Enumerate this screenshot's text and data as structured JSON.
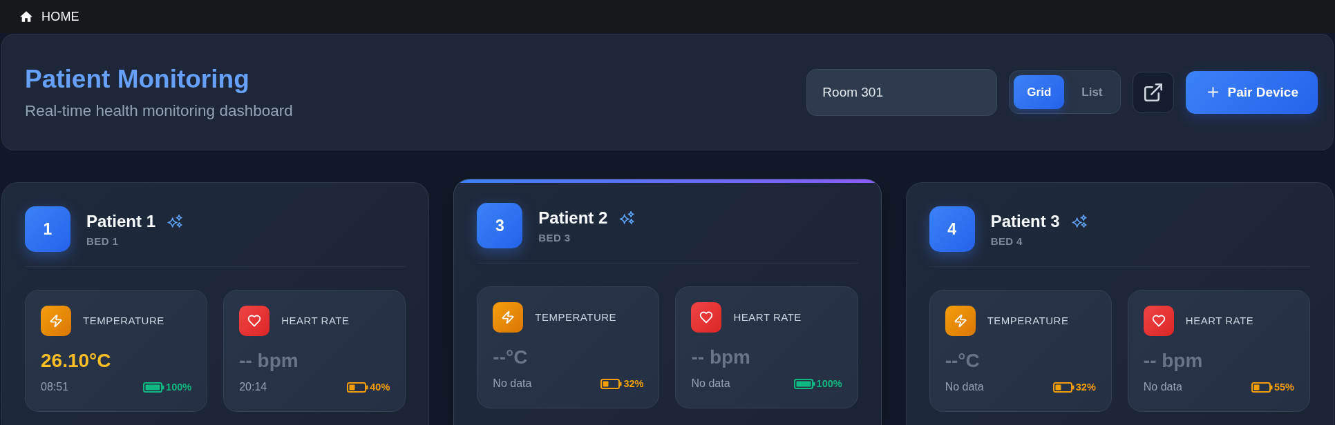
{
  "top_bar": {
    "home_link": "HOME"
  },
  "header": {
    "title": "Patient Monitoring",
    "subtitle": "Real-time health monitoring dashboard",
    "room_field": {
      "value": "Room 301"
    },
    "view_toggle": [
      {
        "label": "Grid",
        "selected": true
      },
      {
        "label": "List",
        "selected": false
      }
    ],
    "pair_button": {
      "label": "Pair Device"
    }
  },
  "patients": [
    {
      "number": "1",
      "name": "Patient 1",
      "bed": "BED 1",
      "highlighted": false,
      "metrics": [
        {
          "kind": "temperature",
          "label": "TEMPERATURE",
          "value": "26.10°C",
          "has_data": true,
          "footer": "08:51",
          "battery": {
            "reading": "100%",
            "low": false
          }
        },
        {
          "kind": "heart_rate",
          "label": "HEART RATE",
          "value": "-- bpm",
          "has_data": false,
          "footer": "20:14",
          "battery": {
            "reading": "40%",
            "low": true
          }
        }
      ]
    },
    {
      "number": "3",
      "name": "Patient 2",
      "bed": "BED 3",
      "highlighted": true,
      "metrics": [
        {
          "kind": "temperature",
          "label": "TEMPERATURE",
          "value": "--°C",
          "has_data": false,
          "footer": "No data",
          "battery": {
            "reading": "32%",
            "low": true
          }
        },
        {
          "kind": "heart_rate",
          "label": "HEART RATE",
          "value": "-- bpm",
          "has_data": false,
          "footer": "No data",
          "battery": {
            "reading": "100%",
            "low": false
          }
        }
      ]
    },
    {
      "number": "4",
      "name": "Patient 3",
      "bed": "BED 4",
      "highlighted": false,
      "metrics": [
        {
          "kind": "temperature",
          "label": "TEMPERATURE",
          "value": "--°C",
          "has_data": false,
          "footer": "No data",
          "battery": {
            "reading": "32%",
            "low": true
          }
        },
        {
          "kind": "heart_rate",
          "label": "HEART RATE",
          "value": "-- bpm",
          "has_data": false,
          "footer": "No data",
          "battery": {
            "reading": "55%",
            "low": true
          }
        }
      ]
    }
  ]
}
